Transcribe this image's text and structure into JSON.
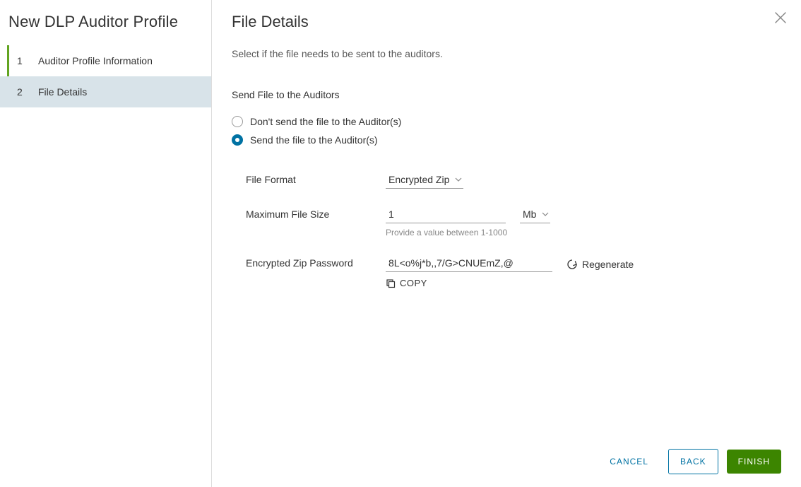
{
  "sidebar": {
    "title": "New DLP Auditor Profile",
    "steps": [
      {
        "num": "1",
        "label": "Auditor Profile Information"
      },
      {
        "num": "2",
        "label": "File Details"
      }
    ]
  },
  "main": {
    "title": "File Details",
    "subtitle": "Select if the file needs to be sent to the auditors.",
    "section_heading": "Send File to the Auditors",
    "radios": {
      "dont_send": "Don't send the file to the Auditor(s)",
      "send": "Send the file to the Auditor(s)"
    },
    "fields": {
      "file_format": {
        "label": "File Format",
        "value": "Encrypted Zip"
      },
      "max_size": {
        "label": "Maximum File Size",
        "value": "1",
        "unit": "Mb",
        "help": "Provide a value between 1-1000"
      },
      "password": {
        "label": "Encrypted Zip Password",
        "value": "8L<o%j*b,,7/G>CNUEmZ,@",
        "regenerate": "Regenerate",
        "copy": "COPY"
      }
    }
  },
  "footer": {
    "cancel": "CANCEL",
    "back": "BACK",
    "finish": "FINISH"
  }
}
